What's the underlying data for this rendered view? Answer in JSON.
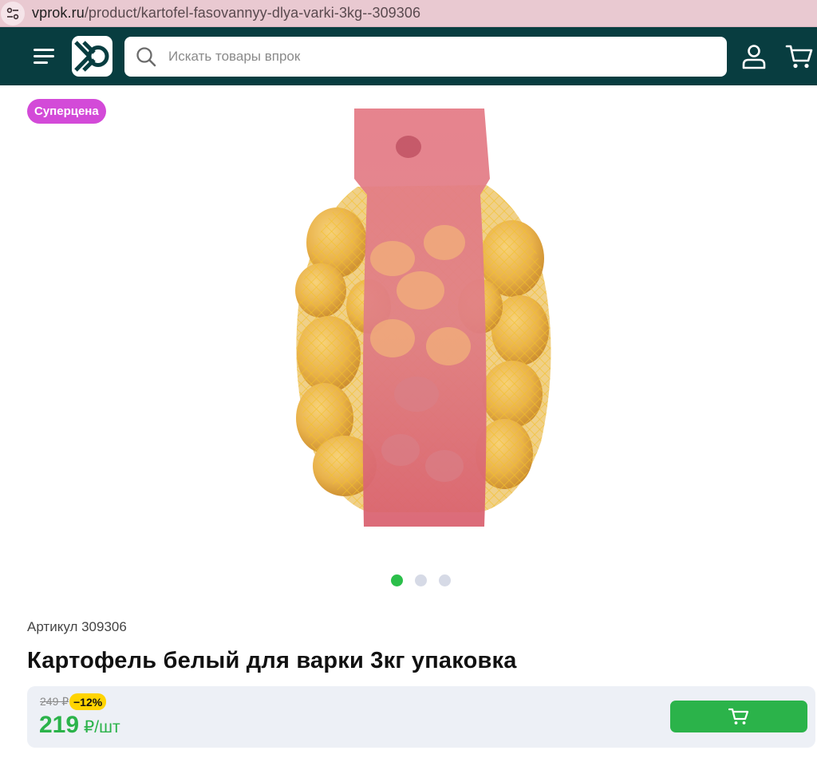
{
  "browser": {
    "url_host": "vprok.ru",
    "url_path": "/product/kartofel-fasovannyy-dlya-varki-3kg--309306",
    "site_icon": "site-settings-icon"
  },
  "header": {
    "menu_icon": "hamburger-menu-icon",
    "logo": "vprok-logo",
    "search_placeholder": "Искать товары впрок",
    "profile_icon": "user-icon",
    "cart_icon": "cart-icon",
    "background_color": "#083d40"
  },
  "product": {
    "badge": "Суперцена",
    "badge_color": "#d34ad8",
    "image_alt": "potato-net-bag",
    "gallery": {
      "count": 3,
      "active": 1
    },
    "sku_label": "Артикул 309306",
    "title": "Картофель белый для варки 3кг упаковка",
    "old_price": "249 ₽",
    "discount": "−12%",
    "price": "219",
    "price_unit": " ₽/шт",
    "price_color": "#2bb34a",
    "buy_icon": "add-to-cart-icon"
  }
}
